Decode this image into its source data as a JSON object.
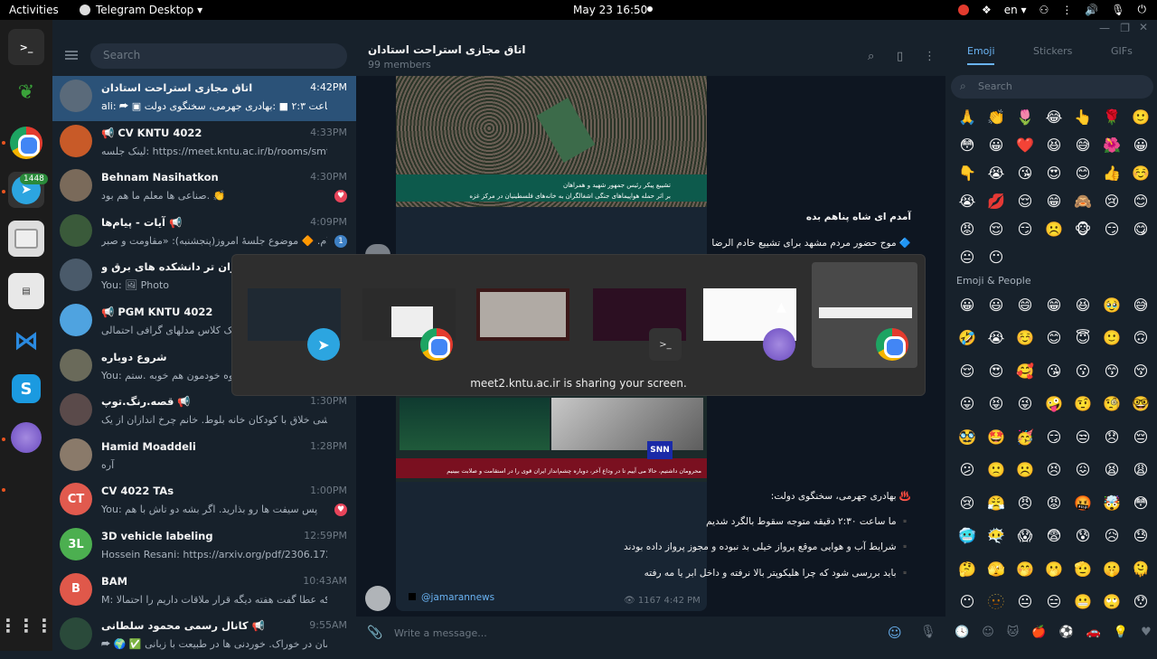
{
  "topbar": {
    "activities": "Activities",
    "app": "Telegram Desktop ▾",
    "clock": "May 23  16:50",
    "lang": "en ▾"
  },
  "dock": {
    "badge": "1448"
  },
  "sidebar": {
    "search_placeholder": "Search",
    "chats": [
      {
        "name": "اتاق مجازی استراحت استادان",
        "time": "4:42PM",
        "msg": "ali: ⮫ ▣ ما ساعت ۲:۳ ■ :بهادری جهرمی، سخنگوی دولت",
        "color": "#5a6a7a"
      },
      {
        "name": "📢 CV KNTU 4022",
        "time": "4:33PM",
        "msg": "لینک جلسه: https://meet.kntu.ac.ir/b/rooms/smt-j94-m...",
        "color": "#c85a28"
      },
      {
        "name": "Behnam Nasihatkon",
        "time": "4:30PM",
        "msg": "صناعی ها  معلم ما هم بود. 👏",
        "color": "#7a6a5a"
      },
      {
        "name": "آیات - پیام‌ها 📢",
        "time": "4:09PM",
        "msg": "سلام. 🔶 موضوع جلسهٔ امروز(پنجشنبه): «مقاومت و صبر",
        "color": "#3a5a3a"
      },
      {
        "name": "و جوان تر دانشکده های برق و",
        "time": "",
        "msg": "You: 🖼 Photo",
        "color": "#4a5a6a"
      },
      {
        "name": "📢 PGM KNTU 4022",
        "time": "",
        "msg": "لینک کلاس مدلهای گرافی احتمالی",
        "color": "#4fa3e0"
      },
      {
        "name": "شروع دوباره",
        "time": "",
        "msg": "You: کوه خودمون هم خوبه .ستم",
        "color": "#6a6a5a"
      },
      {
        "name": "قصه.رنگ.توپ 📢",
        "time": "1:30PM",
        "msg": "نقاشی خلاق با کودکان خانه بلوط. خانم چرخ اندازان از یک",
        "color": "#5a4a4a"
      },
      {
        "name": "Hamid Moaddeli",
        "time": "1:28PM",
        "msg": "آره",
        "color": "#8a7a6a"
      },
      {
        "name": "CV 4022 TAs",
        "time": "1:00PM",
        "msg": "You: پس سیفت ها رو بذارید. اگر بشه دو تاش با هم",
        "color": "#e15a4e",
        "initials": "CT"
      },
      {
        "name": "3D vehicle labeling",
        "time": "12:59PM",
        "msg": "Hossein Resani: https://arxiv.org/pdf/2306.17253  Tow...",
        "color": "#4caf50",
        "initials": "3L"
      },
      {
        "name": "BAM",
        "time": "10:43AM",
        "msg": "M: اون کسی که عطا گفت هفته دیگه قرار ملاقات داریم را احتمالا",
        "color": "#e0584a",
        "initials": "B"
      },
      {
        "name": "کانال رسمی محمود سلطانی 📢",
        "time": "9:55AM",
        "msg": "⮫ 🌍 ✅ مدیریت زمان در خوراک. خوردنی ها در طبیعت با زبانی",
        "color": "#2a4a3a"
      }
    ]
  },
  "chat_header": {
    "title": "اتاق مجازی استراحت استادان",
    "members": "99 members"
  },
  "messages": {
    "m1": "آمدم ای شاه پناهم بده",
    "m2": "🔷 موج حضور مردم مشهد برای تشییع خادم الرضا",
    "m3": "♨️ بهادری جهرمی، سخنگوی دولت:",
    "m4": "▪️ ما ساعت ۲:۳۰ دقیقه متوجه سقوط بالگرد شدیم",
    "m5": "▪️ شرایط آب و هوایی موقع پرواز خیلی بد نبوده و مجوز پرواز داده بودند",
    "m6": "▪️ باید بررسی شود که چرا هلیکوپتر بالا نرفته و داخل ابر یا مه رفته",
    "signature": "@jamarannews",
    "views": "👁 1167  4:42 PM",
    "photo1_line1": "تشییع پیکر رئیس جمهور شهید و همراهان",
    "photo1_line2": "بر اثر حمله هواپیماهای جنگی اشغالگران به خانه‌های فلسطینیان در مرکز غزه",
    "photo2_text": "محرومان داشتیم، حالا می آییم تا در وداع آخر، دوباره چشم‌انداز ایران قوی را در استقامت و صلابت ببینیم",
    "snn": "SNN"
  },
  "composer": {
    "placeholder": "Write a message..."
  },
  "share_overlay": {
    "caption": "meet2.kntu.ac.ir is sharing your screen."
  },
  "emoji_panel": {
    "tabs": [
      "Emoji",
      "Stickers",
      "GIFs"
    ],
    "search_placeholder": "Search",
    "section": "Emoji & People",
    "recent": [
      "🙏",
      "👏",
      "🌷",
      "😂",
      "👆",
      "🌹",
      "🙂",
      "😄",
      "😳",
      "😀",
      "❤️",
      "😆",
      "😅",
      "🌺",
      "😀",
      "😉",
      "👇",
      "😭",
      "😘",
      "😍",
      "😊",
      "👍",
      "☺️",
      "😏",
      "😭",
      "💋",
      "😌",
      "😁",
      "🙈",
      "😢",
      "😊",
      "😱",
      "😡",
      "😌",
      "😏",
      "☹️",
      "🐵",
      "😏",
      "😋",
      "👌",
      "😐",
      "😶"
    ],
    "people": [
      "😀",
      "😃",
      "😄",
      "😁",
      "😆",
      "🥹",
      "😅",
      "😂",
      "🤣",
      "😭",
      "☺️",
      "😊",
      "😇",
      "🙂",
      "🙃",
      "😉",
      "😌",
      "😍",
      "🥰",
      "😘",
      "😗",
      "😙",
      "😚",
      "😋",
      "😛",
      "😝",
      "😜",
      "🤪",
      "🤨",
      "🧐",
      "🤓",
      "😎",
      "🥸",
      "🤩",
      "🥳",
      "😏",
      "😒",
      "😞",
      "😔",
      "😟",
      "😕",
      "🙁",
      "☹️",
      "😣",
      "😖",
      "😫",
      "😩",
      "🥺",
      "😢",
      "😤",
      "😠",
      "😡",
      "🤬",
      "🤯",
      "😳",
      "🥵",
      "🥶",
      "😶‍🌫️",
      "😱",
      "😨",
      "😰",
      "😥",
      "😓",
      "🤗",
      "🤔",
      "🫣",
      "🤭",
      "🫢",
      "🫡",
      "🤫",
      "🫠",
      "🤥",
      "😶",
      "🫥",
      "😐",
      "😑",
      "😬",
      "🙄",
      "😯"
    ]
  }
}
